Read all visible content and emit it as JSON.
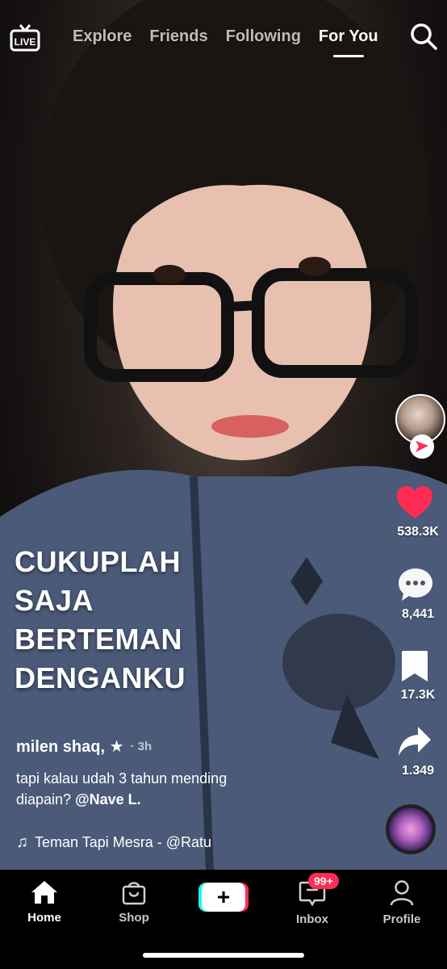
{
  "top_nav": {
    "live_label": "LIVE",
    "tabs": [
      "Explore",
      "Friends",
      "Following",
      "For You"
    ],
    "active_tab": "For You"
  },
  "video": {
    "overlay_lines": [
      "CUKUPLAH",
      "SAJA",
      "BERTEMAN",
      "DENGANKU"
    ]
  },
  "rail": {
    "likes": "538.3K",
    "comments": "8,441",
    "saves": "17.3K",
    "shares": "1.349"
  },
  "caption": {
    "author": "milen shaq, ★",
    "time": "· 3h",
    "text_line1": "tapi kalau udah 3 tahun mending",
    "text_line2_prefix": "diapain? ",
    "mention": "@Nave L.",
    "music": "Teman Tapi Mesra - @Ratu"
  },
  "bottom_nav": {
    "home": "Home",
    "shop": "Shop",
    "create": "+",
    "inbox": "Inbox",
    "inbox_badge": "99+",
    "profile": "Profile"
  },
  "colors": {
    "accent": "#fe2c55",
    "cyan": "#25f4ee",
    "sweater": "#4a5a78"
  }
}
